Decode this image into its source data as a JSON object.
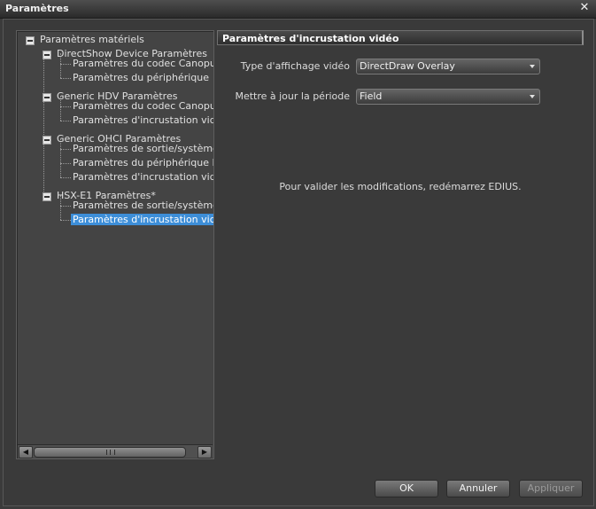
{
  "window": {
    "title": "Paramètres",
    "close_glyph": "✕"
  },
  "tree": {
    "root": "Paramètres matériels",
    "groups": [
      {
        "label": "DirectShow Device Paramètres",
        "children": [
          "Paramètres du codec Canopus HQ",
          "Paramètres du périphérique"
        ]
      },
      {
        "label": "Generic HDV Paramètres",
        "children": [
          "Paramètres du codec Canopus HQ",
          "Paramètres d'incrustation vidéo"
        ]
      },
      {
        "label": "Generic OHCI Paramètres",
        "children": [
          "Paramètres de sortie/système",
          "Paramètres du périphérique DV",
          "Paramètres d'incrustation vidéo"
        ]
      },
      {
        "label": "HSX-E1 Paramètres*",
        "children": [
          "Paramètres de sortie/système",
          "Paramètres d'incrustation vidéo"
        ]
      }
    ],
    "selected": "Paramètres d'incrustation vidéo",
    "scroll_left": "◀",
    "scroll_right": "▶"
  },
  "panel": {
    "header": "Paramètres d'incrustation vidéo",
    "fields": {
      "display_type": {
        "label": "Type d'affichage vidéo",
        "value": "DirectDraw Overlay"
      },
      "update_period": {
        "label": "Mettre à jour la période",
        "value": "Field"
      }
    },
    "notice": "Pour valider les modifications, redémarrez EDIUS."
  },
  "buttons": {
    "ok": "OK",
    "cancel": "Annuler",
    "apply": "Appliquer"
  },
  "colors": {
    "selection": "#3d8ed8",
    "background": "#3a3a3a"
  },
  "icons": {
    "expander": "minus-box-icon",
    "close": "close-icon"
  }
}
